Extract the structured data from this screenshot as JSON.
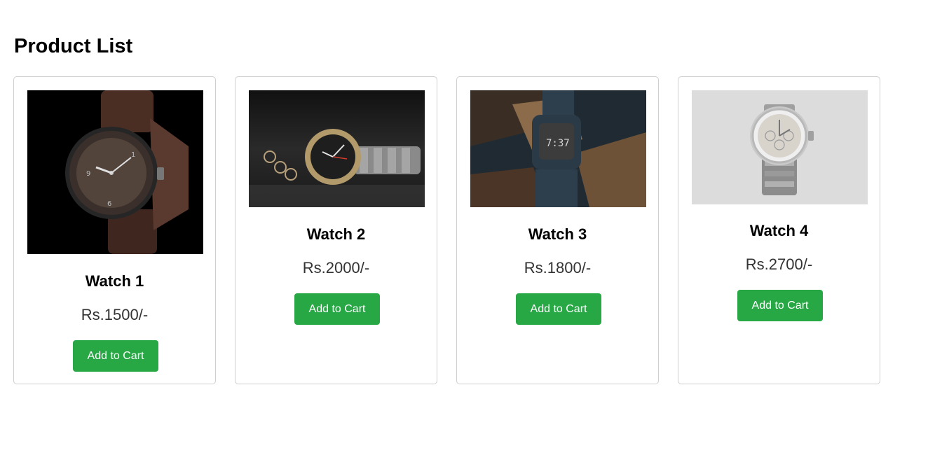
{
  "page": {
    "title": "Product List"
  },
  "theme": {
    "button_color": "#28a745",
    "button_text_color": "#ffffff",
    "card_border_color": "#cfcfcf"
  },
  "products": [
    {
      "name": "Watch 1",
      "price": "Rs.1500/-",
      "button_label": "Add to Cart",
      "image_icon": "brown-strap-wristwatch-photo"
    },
    {
      "name": "Watch 2",
      "price": "Rs.2000/-",
      "button_label": "Add to Cart",
      "image_icon": "steel-band-wristwatch-photo"
    },
    {
      "name": "Watch 3",
      "price": "Rs.1800/-",
      "button_label": "Add to Cart",
      "image_icon": "digital-sport-watch-photo"
    },
    {
      "name": "Watch 4",
      "price": "Rs.2700/-",
      "button_label": "Add to Cart",
      "image_icon": "silver-chronograph-watch-photo"
    }
  ]
}
